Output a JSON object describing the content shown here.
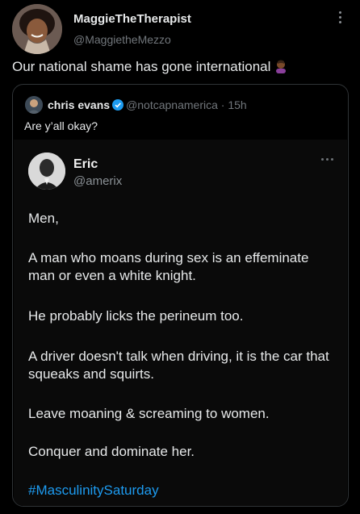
{
  "author": {
    "name": "MaggieTheTherapist",
    "handle": "@MaggietheMezzo"
  },
  "tweet": {
    "text": "Our national shame has gone international",
    "emoji": "woman-facepalming-emoji"
  },
  "quote": {
    "name": "chris evans",
    "handle": "@notcapnamerica",
    "time": "· 15h",
    "text": "Are y’all okay?",
    "embedded": {
      "name": "Eric",
      "handle": "@amerix",
      "paragraphs": [
        "Men,",
        "A man who moans during sex is an effeminate man or even a white knight.",
        "He probably licks the perineum too.",
        "A driver doesn't talk when driving, it is the car that squeaks and squirts.",
        "Leave moaning & screaming to women.",
        "Conquer and dominate her."
      ],
      "hashtag": "#MasculinitySaturday"
    }
  },
  "colors": {
    "background": "#000000",
    "text": "#e7e9ea",
    "muted": "#71767b",
    "accent": "#1d9bf0",
    "border": "#2f3336"
  },
  "icons": {
    "more": "more-vertical-icon",
    "verified": "verified-badge-icon",
    "inner_more": "more-horizontal-icon"
  }
}
